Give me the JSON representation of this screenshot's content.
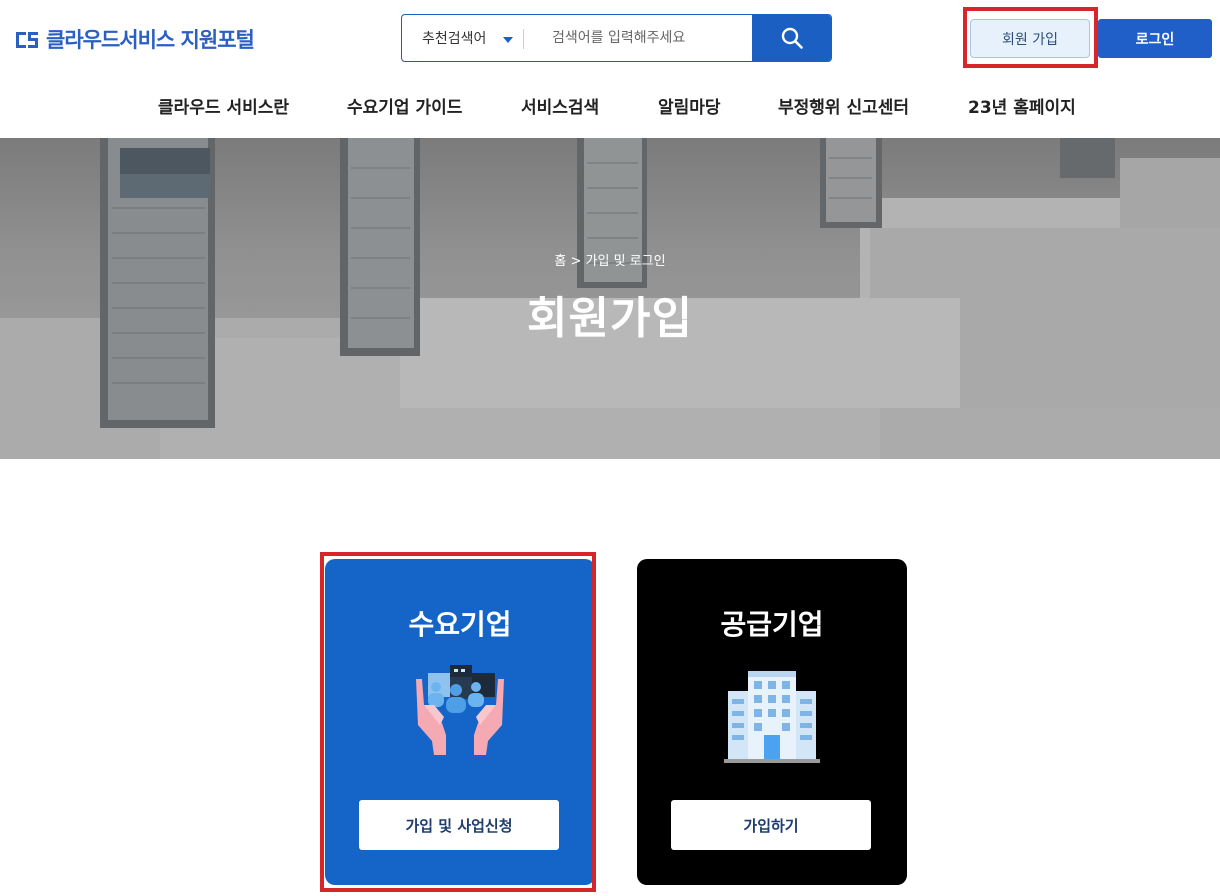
{
  "brand": {
    "logo_text": "클라우드서비스 지원포털",
    "accent": "#1a5fc1",
    "highlight": "#d7252c"
  },
  "search": {
    "category_label": "추천검색어",
    "placeholder": "검색어를 입력해주세요",
    "button_icon": "search-icon"
  },
  "header": {
    "join_label": "회원 가입",
    "login_label": "로그인"
  },
  "nav": {
    "items": [
      {
        "label": "클라우드 서비스란"
      },
      {
        "label": "수요기업 가이드"
      },
      {
        "label": "서비스검색"
      },
      {
        "label": "알림마당"
      },
      {
        "label": "부정행위 신고센터"
      },
      {
        "label": "23년 홈페이지"
      }
    ]
  },
  "hero": {
    "breadcrumb": "홈 > 가입 및 로그인",
    "title": "회원가입"
  },
  "cards": [
    {
      "title": "수요기업",
      "icon": "hands-people-icon",
      "button_label": "가입 및 사업신청",
      "color": "#1565c8"
    },
    {
      "title": "공급기업",
      "icon": "building-icon",
      "button_label": "가입하기",
      "color": "#000000"
    }
  ]
}
